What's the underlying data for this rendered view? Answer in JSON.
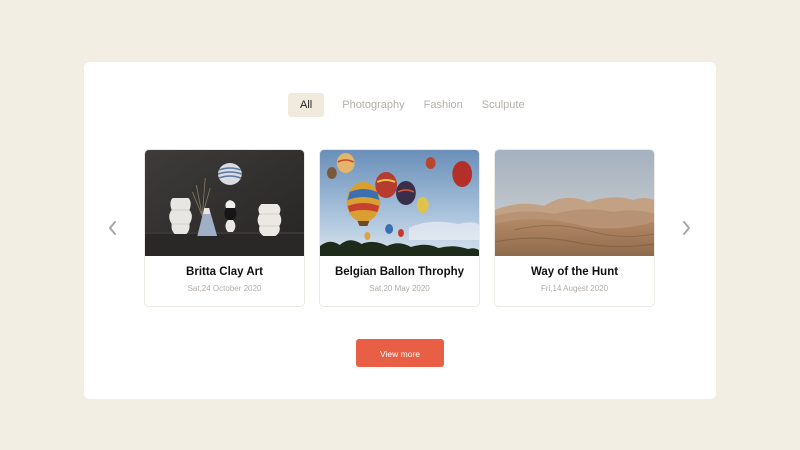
{
  "tabs": [
    {
      "label": "All",
      "active": true
    },
    {
      "label": "Photography",
      "active": false
    },
    {
      "label": "Fashion",
      "active": false
    },
    {
      "label": "Sculpute",
      "active": false
    }
  ],
  "carousel": {
    "prev_icon": "chevron-left-icon",
    "next_icon": "chevron-right-icon",
    "cards": [
      {
        "title": "Britta Clay Art",
        "date": "Sat,24 October 2020",
        "image": "ceramic-vases-photo"
      },
      {
        "title": "Belgian Ballon Throphy",
        "date": "Sat,20 May 2020",
        "image": "hot-air-balloons-photo"
      },
      {
        "title": "Way of the Hunt",
        "date": "Fri,14 Augest 2020",
        "image": "desert-dunes-photo"
      }
    ]
  },
  "actions": {
    "view_more_label": "View more"
  },
  "colors": {
    "background": "#f3eee4",
    "panel": "#ffffff",
    "accent": "#e95f45",
    "active_tab": "#f1ebde"
  }
}
